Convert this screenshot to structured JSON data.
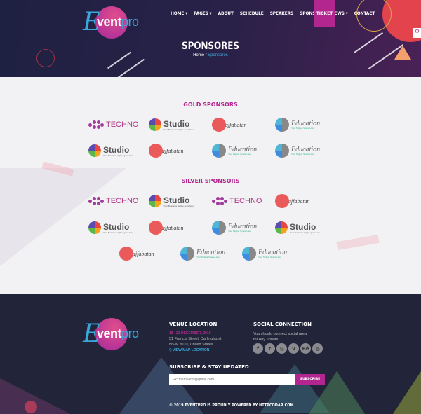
{
  "header": {
    "logo": {
      "letter": "E",
      "bold": "vent",
      "light": "pro"
    },
    "nav": [
      "HOME ▾",
      "PAGES ▾",
      "ABOUT",
      "SCHEDULE",
      "SPEAKERS",
      "SPONSORS",
      "NEWS ▾",
      "CONTACT"
    ],
    "ticket": "TICKET",
    "title": "SPONSORES",
    "breadcrumb": {
      "home": "Home",
      "sep": "/",
      "current": "Sponsores"
    }
  },
  "logos": {
    "techno": "TECHNO",
    "studio": "Studio",
    "studio_tag": "Your Business tagline goes here",
    "raj": "Rajfabatan",
    "edu": "Education",
    "edu_tag": "Your Tagline Space Here"
  },
  "gold": {
    "title": "GOLD SPONSORS",
    "rows": [
      [
        "techno",
        "studio",
        "raj",
        "edu"
      ],
      [
        "studio",
        "raj",
        "edu",
        "edu"
      ]
    ]
  },
  "silver": {
    "title": "SILVER SPONSORS",
    "rows": [
      [
        "techno",
        "studio",
        "techno",
        "raj"
      ],
      [
        "studio",
        "raj",
        "edu",
        "studio"
      ],
      [
        "raj",
        "edu",
        "edu"
      ]
    ]
  },
  "footer": {
    "venue_title": "VENUE LOCATION",
    "date": "18 - 21 DECEMBER, 2019",
    "address1": "51 Francis Street, Darlinghurst",
    "address2": "NSW 2010, United States",
    "map_link": "⚲ VIEW MAP LOCATION",
    "social_title": "SOCIAL CONNECTION",
    "social_text1": "You should connect social area",
    "social_text2": "for Any update",
    "social": [
      {
        "name": "facebook-icon",
        "glyph": "f"
      },
      {
        "name": "twitter-icon",
        "glyph": "t"
      },
      {
        "name": "instagram-icon",
        "glyph": "◎"
      },
      {
        "name": "vimeo-icon",
        "glyph": "v"
      },
      {
        "name": "behance-icon",
        "glyph": "Bē"
      },
      {
        "name": "dribbble-icon",
        "glyph": "◍"
      }
    ],
    "subscribe_title": "SUBSCRIBE & STAY UPDATED",
    "email_placeholder": "Ex: themearth@gmail.com",
    "subscribe_btn": "SUBSCRIBE",
    "copyright": "© 2019 EVENTPRO IS PROUDLY POWERED BY HTTPCODAR.COM"
  },
  "colors": {
    "accent": "#b4268f",
    "blue": "#3aa7dd",
    "footer_bg": "#222539"
  }
}
